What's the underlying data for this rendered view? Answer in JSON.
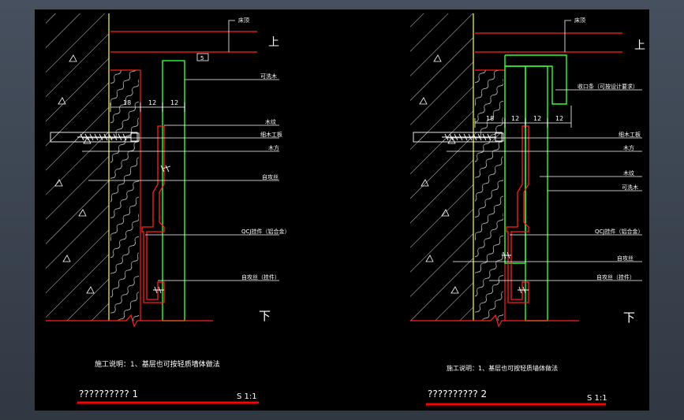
{
  "colors": {
    "background": "#000000",
    "wall": "#ffffff",
    "red": "#ff2020",
    "green": "#30ff30",
    "yellow": "#ffff40",
    "text": "#ffffff",
    "titlebar": "#ff0000"
  },
  "left": {
    "top_label": "上",
    "bottom_label": "下",
    "ceiling_callout": "床顶",
    "gap_dim": "5",
    "dims": [
      "18",
      "12",
      "12"
    ],
    "callouts": [
      "可洗木",
      "木纹",
      "细木工板",
      "木方",
      "自攻丝",
      "QCJ挂件（铝合金）",
      "自攻丝（挂件）"
    ],
    "note": "施工说明：1、基层也可按轻质墙体做法",
    "title": "?????????? 1",
    "scale": "S 1:1"
  },
  "right": {
    "top_label": "上",
    "bottom_label": "下",
    "ceiling_callout": "床顶",
    "dims": [
      "18",
      "12",
      "12",
      "12"
    ],
    "callouts": [
      "收口条（可按设计要求）",
      "细木工板",
      "木方",
      "木纹",
      "可洗木",
      "QCJ挂件（铝合金）",
      "自攻丝",
      "自攻丝（挂件）"
    ],
    "note": "施工说明：1、基层也可按轻质墙体做法",
    "title": "?????????? 2",
    "scale": "S 1:1"
  }
}
